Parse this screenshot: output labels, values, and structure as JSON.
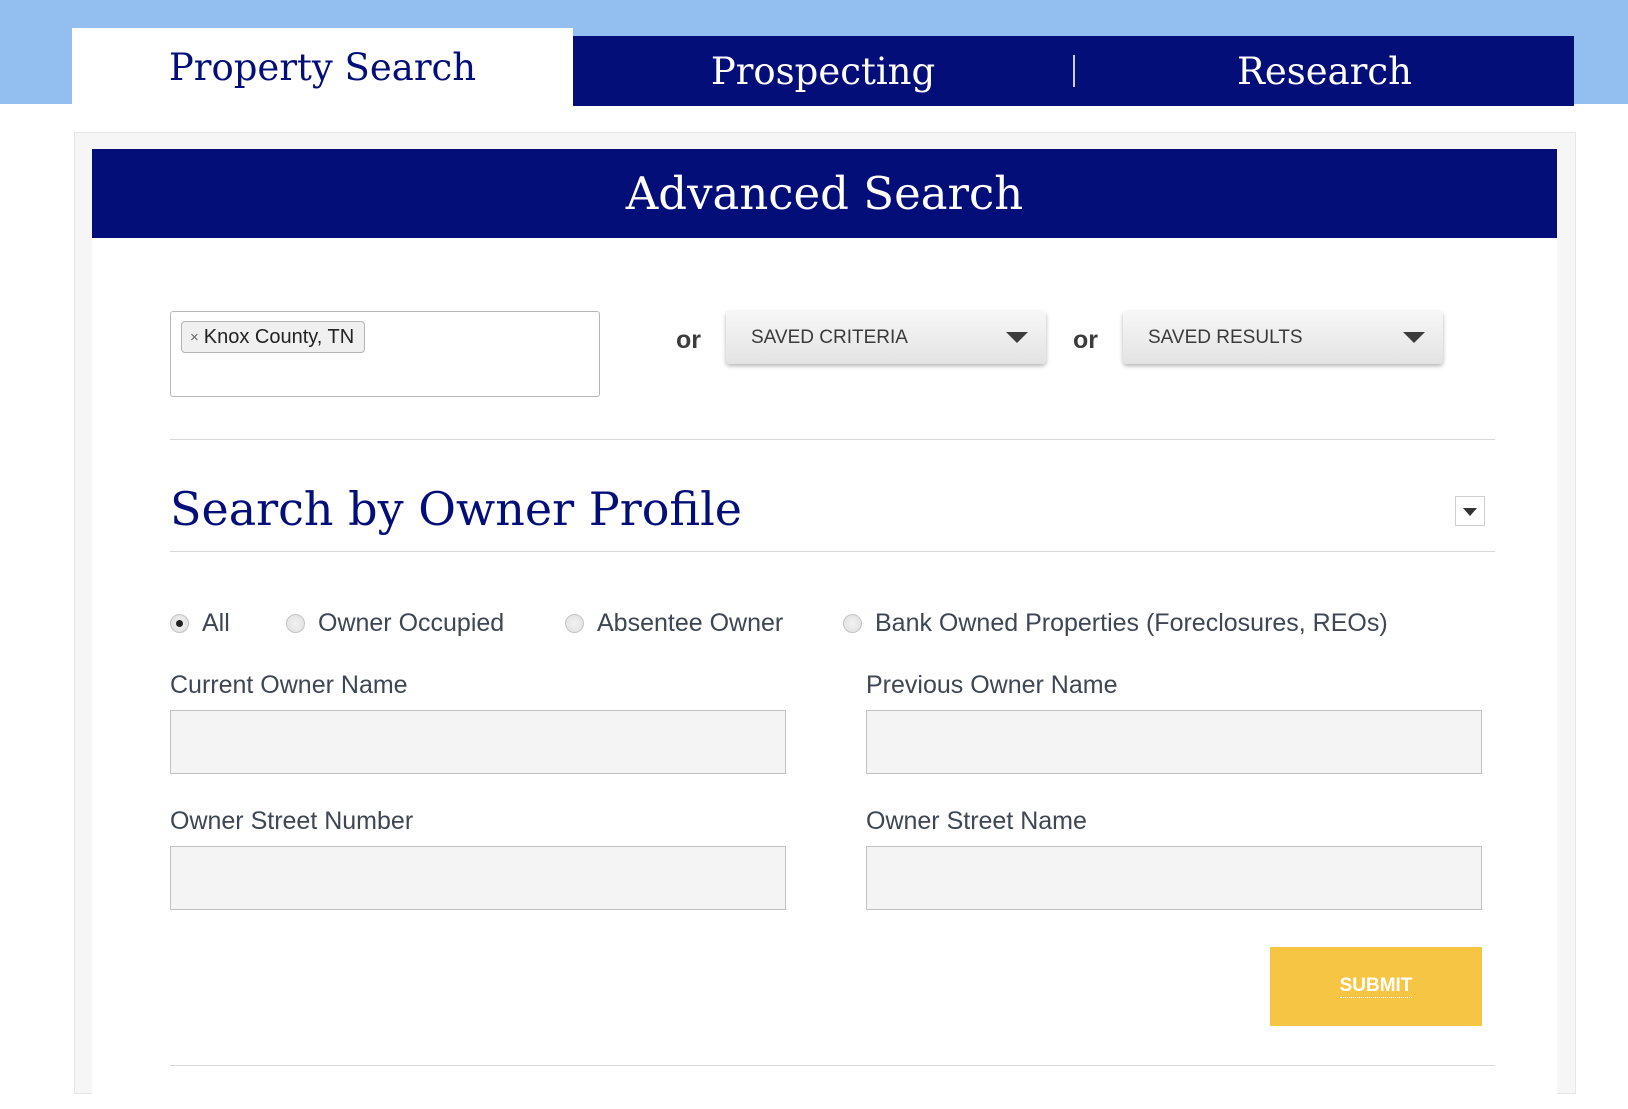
{
  "tabs": [
    {
      "label": "Property Search",
      "active": true
    },
    {
      "label": "Prospecting",
      "active": false
    },
    {
      "label": "Research",
      "active": false
    }
  ],
  "panel": {
    "title": "Advanced Search"
  },
  "location": {
    "chip_label": "Knox County, TN",
    "chip_remove": "×"
  },
  "or_label": "or",
  "saved_criteria": {
    "label": "SAVED CRITERIA"
  },
  "saved_results": {
    "label": "SAVED RESULTS"
  },
  "owner_section": {
    "title": "Search by Owner Profile",
    "radios": [
      {
        "label": "All",
        "checked": true
      },
      {
        "label": "Owner Occupied",
        "checked": false
      },
      {
        "label": "Absentee Owner",
        "checked": false
      },
      {
        "label": "Bank Owned Properties (Foreclosures, REOs)",
        "checked": false
      }
    ],
    "fields": {
      "current_owner_name": {
        "label": "Current Owner Name",
        "value": ""
      },
      "previous_owner_name": {
        "label": "Previous Owner Name",
        "value": ""
      },
      "owner_street_number": {
        "label": "Owner Street Number",
        "value": ""
      },
      "owner_street_name": {
        "label": "Owner Street Name",
        "value": ""
      }
    },
    "submit_label": "SUBMIT"
  },
  "colors": {
    "navy": "#040e78",
    "sky": "#92bff0",
    "submit": "#f7c544"
  }
}
